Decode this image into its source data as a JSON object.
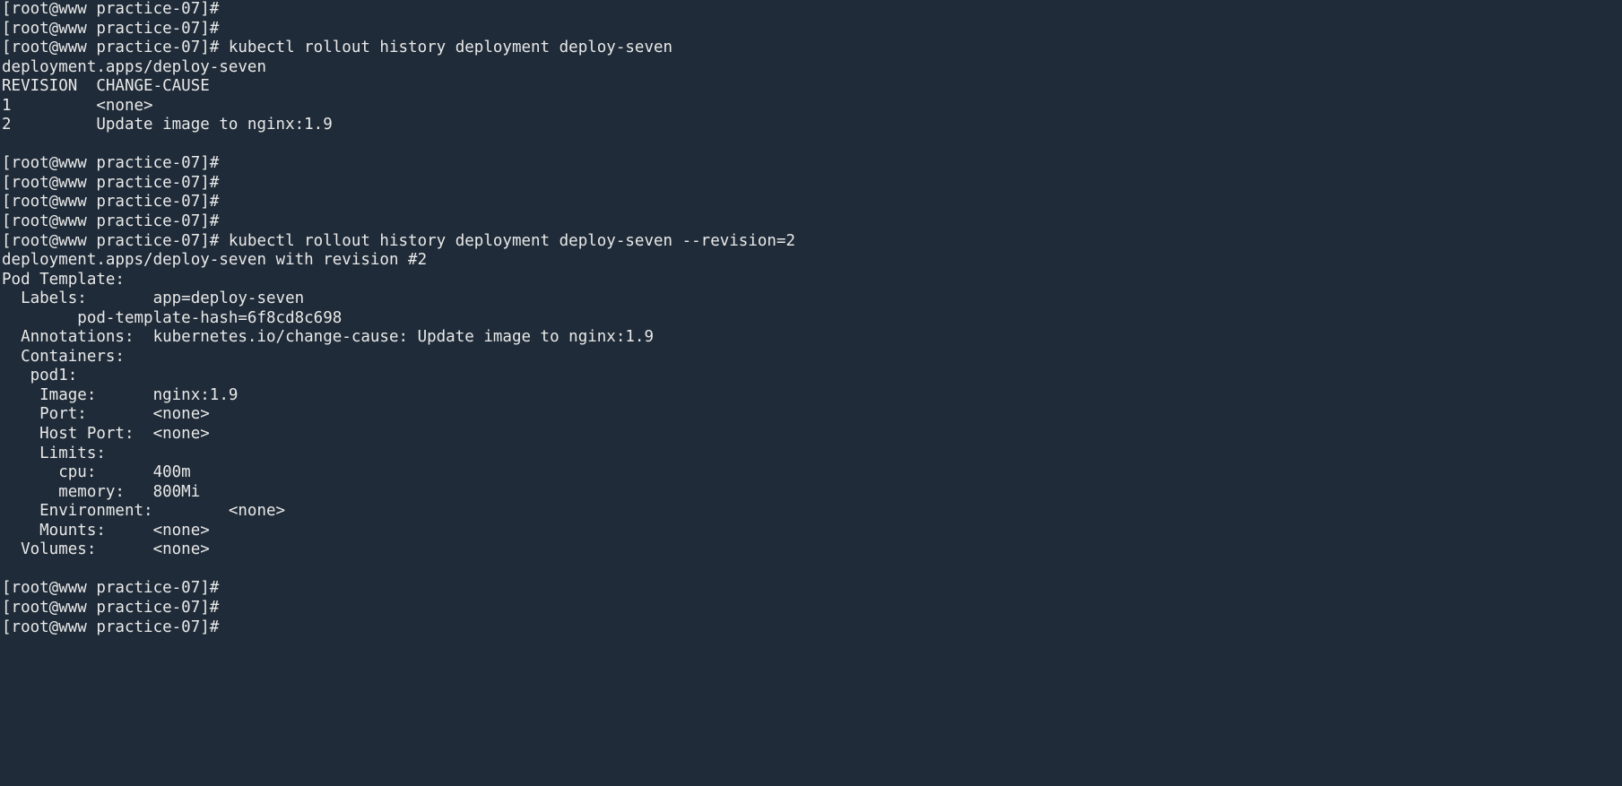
{
  "terminal": {
    "background_color": "#1f2b38",
    "foreground_color": "#e9e9e9",
    "prompt": "[root@www practice-07]#",
    "lines": [
      {
        "id": "l01",
        "text": "[root@www practice-07]#"
      },
      {
        "id": "l02",
        "text": "[root@www practice-07]#"
      },
      {
        "id": "l03",
        "text": "[root@www practice-07]# kubectl rollout history deployment deploy-seven"
      },
      {
        "id": "l04",
        "text": "deployment.apps/deploy-seven"
      },
      {
        "id": "l05",
        "text": "REVISION  CHANGE-CAUSE"
      },
      {
        "id": "l06",
        "text": "1         <none>"
      },
      {
        "id": "l07",
        "text": "2         Update image to nginx:1.9"
      },
      {
        "id": "l08",
        "text": ""
      },
      {
        "id": "l09",
        "text": "[root@www practice-07]#"
      },
      {
        "id": "l10",
        "text": "[root@www practice-07]#"
      },
      {
        "id": "l11",
        "text": "[root@www practice-07]#"
      },
      {
        "id": "l12",
        "text": "[root@www practice-07]#"
      },
      {
        "id": "l13",
        "text": "[root@www practice-07]# kubectl rollout history deployment deploy-seven --revision=2"
      },
      {
        "id": "l14",
        "text": "deployment.apps/deploy-seven with revision #2"
      },
      {
        "id": "l15",
        "text": "Pod Template:"
      },
      {
        "id": "l16",
        "text": "  Labels:       app=deploy-seven"
      },
      {
        "id": "l17",
        "text": "        pod-template-hash=6f8cd8c698"
      },
      {
        "id": "l18",
        "text": "  Annotations:  kubernetes.io/change-cause: Update image to nginx:1.9"
      },
      {
        "id": "l19",
        "text": "  Containers:"
      },
      {
        "id": "l20",
        "text": "   pod1:"
      },
      {
        "id": "l21",
        "text": "    Image:      nginx:1.9"
      },
      {
        "id": "l22",
        "text": "    Port:       <none>"
      },
      {
        "id": "l23",
        "text": "    Host Port:  <none>"
      },
      {
        "id": "l24",
        "text": "    Limits:"
      },
      {
        "id": "l25",
        "text": "      cpu:      400m"
      },
      {
        "id": "l26",
        "text": "      memory:   800Mi"
      },
      {
        "id": "l27",
        "text": "    Environment:        <none>"
      },
      {
        "id": "l28",
        "text": "    Mounts:     <none>"
      },
      {
        "id": "l29",
        "text": "  Volumes:      <none>"
      },
      {
        "id": "l30",
        "text": ""
      },
      {
        "id": "l31",
        "text": "[root@www practice-07]#"
      },
      {
        "id": "l32",
        "text": "[root@www practice-07]#"
      },
      {
        "id": "l33",
        "text": "[root@www practice-07]#"
      }
    ],
    "commands": [
      "kubectl rollout history deployment deploy-seven",
      "kubectl rollout history deployment deploy-seven --revision=2"
    ],
    "rollout_history": {
      "resource": "deployment.apps/deploy-seven",
      "columns": [
        "REVISION",
        "CHANGE-CAUSE"
      ],
      "rows": [
        {
          "revision": "1",
          "change_cause": "<none>"
        },
        {
          "revision": "2",
          "change_cause": "Update image to nginx:1.9"
        }
      ]
    },
    "revision_detail": {
      "header": "deployment.apps/deploy-seven with revision #2",
      "section": "Pod Template:",
      "labels": [
        "app=deploy-seven",
        "pod-template-hash=6f8cd8c698"
      ],
      "annotations": "kubernetes.io/change-cause: Update image to nginx:1.9",
      "container_name": "pod1",
      "image": "nginx:1.9",
      "port": "<none>",
      "host_port": "<none>",
      "limits": {
        "cpu": "400m",
        "memory": "800Mi"
      },
      "environment": "<none>",
      "mounts": "<none>",
      "volumes": "<none>"
    }
  }
}
